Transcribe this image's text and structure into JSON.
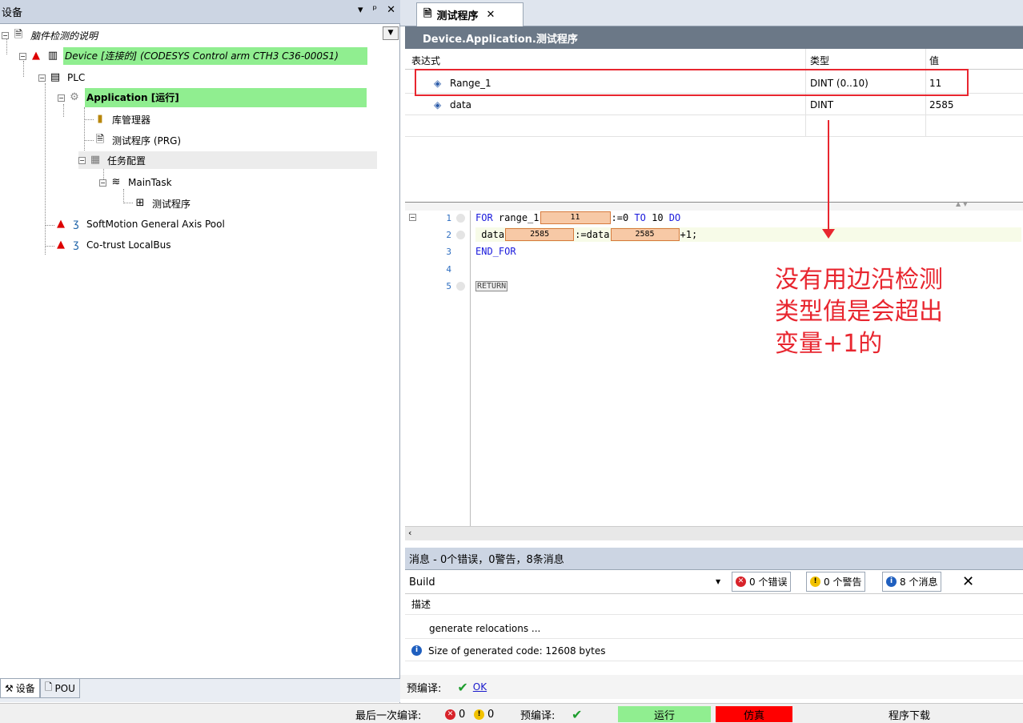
{
  "devices_panel": {
    "title": "设备",
    "tree": {
      "project": "脑件检测的说明",
      "device": "Device [连接的] (CODESYS Control arm CTH3 C36-000S1)",
      "plc": "PLC",
      "application": "Application [运行]",
      "library_manager": "库管理器",
      "test_program": "测试程序 (PRG)",
      "task_config": "任务配置",
      "main_task": "MainTask",
      "task_program": "测试程序",
      "softmotion": "SoftMotion General Axis Pool",
      "localbus": "Co-trust LocalBus"
    },
    "bottom_tabs": [
      "设备",
      "POU"
    ]
  },
  "editor": {
    "tab_label": "测试程序",
    "path_title": "Device.Application.测试程序",
    "watch": {
      "headers": [
        "表达式",
        "类型",
        "值"
      ],
      "rows": [
        {
          "expr": "Range_1",
          "type": "DINT (0..10)",
          "value": "11"
        },
        {
          "expr": "data",
          "type": "DINT",
          "value": "2585"
        }
      ]
    },
    "code": {
      "line_numbers": [
        "1",
        "2",
        "3",
        "4",
        "5"
      ],
      "l1_kw1": "FOR",
      "l1_var": "range_1",
      "l1_val": "11",
      "l1_assign": ":=0",
      "l1_kw2": "TO",
      "l1_to": "10",
      "l1_kw3": "DO",
      "l2_var": "data",
      "l2_val1": "2585",
      "l2_mid": ":=data",
      "l2_val2": "2585",
      "l2_end": "+1;",
      "l3_kw": "END_FOR",
      "l5_ret": "RETURN"
    }
  },
  "annotation": {
    "line1": "没有用边沿检测",
    "line2": "类型值是会超出",
    "line3": "变量+1的"
  },
  "messages": {
    "title": "消息 - 0个错误，0警告，8条消息",
    "source": "Build",
    "errors": "0 个错误",
    "warnings": "0 个警告",
    "infos": "8 个消息",
    "column": "描述",
    "rows": [
      "generate relocations ...",
      "Size of generated code: 12608 bytes"
    ]
  },
  "precompile": {
    "label": "预编译:",
    "status": "OK"
  },
  "statusbar": {
    "last_compile_label": "最后一次编译:",
    "errors": "0",
    "warnings": "0",
    "precompile_label": "预编译:",
    "run": "运行",
    "sim": "仿真",
    "download": "程序下载"
  },
  "colors": {
    "highlight_green": "#90ee90",
    "annotation_red": "#e8262f",
    "sim_red": "#ff0000"
  }
}
